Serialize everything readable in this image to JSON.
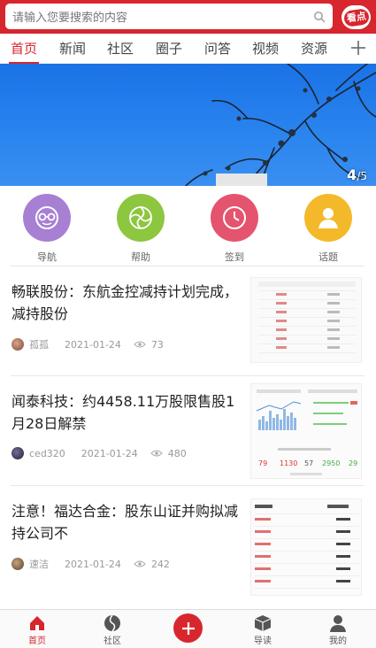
{
  "search": {
    "placeholder": "请输入您要搜索的内容"
  },
  "brand": {
    "logo_text": "看点",
    "color": "#d7262d"
  },
  "tabs": [
    {
      "label": "首页",
      "active": true
    },
    {
      "label": "新闻",
      "active": false
    },
    {
      "label": "社区",
      "active": false
    },
    {
      "label": "圈子",
      "active": false
    },
    {
      "label": "问答",
      "active": false
    },
    {
      "label": "视频",
      "active": false
    },
    {
      "label": "资源",
      "active": false
    }
  ],
  "banner": {
    "current": "4",
    "separator": "/",
    "total": "5"
  },
  "quick_nav": [
    {
      "label": "导航",
      "icon": "glasses-face-icon",
      "color": "#a77fd3"
    },
    {
      "label": "帮助",
      "icon": "swirl-icon",
      "color": "#8dc63f"
    },
    {
      "label": "签到",
      "icon": "clock-icon",
      "color": "#e4546e"
    },
    {
      "label": "话题",
      "icon": "user-icon",
      "color": "#f4b92a"
    }
  ],
  "news": [
    {
      "title": "畅联股份：东航金控减持计划完成，减持股份",
      "author": "孤孤",
      "date": "2021-01-24",
      "views": "73"
    },
    {
      "title": "闻泰科技：约4458.11万股限售股1月28日解禁",
      "author": "ced320",
      "date": "2021-01-24",
      "views": "480"
    },
    {
      "title": "注意！福达合金：股东山证并购拟减持公司不",
      "author": "速洁",
      "date": "2021-01-24",
      "views": "242"
    }
  ],
  "bottom_nav": [
    {
      "label": "首页",
      "icon": "home-icon",
      "active": true
    },
    {
      "label": "社区",
      "icon": "community-icon",
      "active": false
    },
    {
      "label": "导读",
      "icon": "box-icon",
      "active": false
    },
    {
      "label": "我的",
      "icon": "person-icon",
      "active": false
    }
  ]
}
